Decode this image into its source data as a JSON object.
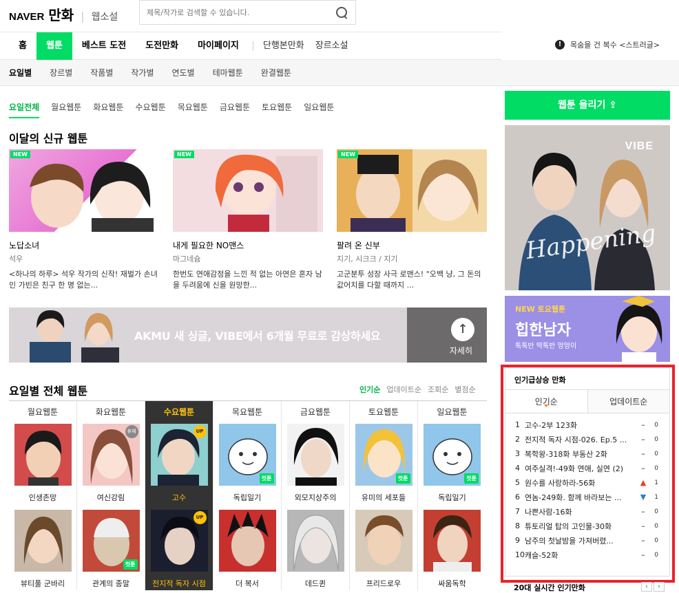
{
  "header": {
    "brand": "NAVER",
    "service": "만화",
    "sub": "웹소설",
    "search_placeholder": "제목/작가로 검색할 수 있습니다."
  },
  "gnb": {
    "items": [
      "홈",
      "웹툰",
      "베스트 도전",
      "도전만화",
      "마이페이지"
    ],
    "extra": [
      "단행본만화",
      "장르소설"
    ],
    "notice": "목숨을 건 복수 <스트러글>"
  },
  "subgnb": [
    "요일별",
    "장르별",
    "작품별",
    "작가별",
    "연도별",
    "테마웹툰",
    "완결웹툰"
  ],
  "daytabs": [
    "요일전체",
    "월요웹툰",
    "화요웹툰",
    "수요웹툰",
    "목요웹툰",
    "금요웹툰",
    "토요웹툰",
    "일요웹툰"
  ],
  "new_section": {
    "title": "이달의 신규 웹툰",
    "badge": "NEW",
    "cards": [
      {
        "title": "노답소녀",
        "author": "석우",
        "desc": "<하나의 하루> 석우 작가의 신작! 재벌가 손녀인 가빈은 친구 한 명 없는..."
      },
      {
        "title": "내게 필요한 NO맨스",
        "author": "마그네슘",
        "desc": "한번도 연애감정을 느낀 적 없는 아연은 혼자 남을 두려움에 신을 원망한..."
      },
      {
        "title": "팔려 온 신부",
        "author": "지기, 시크크 / 지기",
        "desc": "고군분투 성장 사극 로맨스! \"오백 냥, 그 돈의 값어치를 다할 때까지 ..."
      }
    ]
  },
  "banner": {
    "text": "AKMU 새 싱글, VIBE에서 6개월 무료로 감상하세요",
    "more": "자세히"
  },
  "daily": {
    "title": "요일별 전체 웹툰",
    "sorts": [
      "인기순",
      "업데이트순",
      "조회순",
      "별점순"
    ],
    "columns": [
      {
        "day": "월요웹툰",
        "items": [
          "인생존망",
          "뷰티풀 군바리"
        ]
      },
      {
        "day": "화요웹툰",
        "items": [
          "여신강림",
          "관계의 종말"
        ]
      },
      {
        "day": "수요웹툰",
        "items": [
          "고수",
          "전지적 독자 시점"
        ]
      },
      {
        "day": "목요웹툰",
        "items": [
          "독립일기",
          "더 복서"
        ]
      },
      {
        "day": "금요웹툰",
        "items": [
          "외모지상주의",
          "데드퀸"
        ]
      },
      {
        "day": "토요웹툰",
        "items": [
          "유미의 세포들",
          "프리드로우"
        ]
      },
      {
        "day": "일요웹툰",
        "items": [
          "독립일기",
          "싸움독학"
        ]
      }
    ],
    "badges": {
      "up": "UP",
      "rest": "휴재",
      "cut": "컷툰"
    }
  },
  "right": {
    "upload": "웹툰 올리기",
    "vibe": {
      "logo": "VIBE",
      "script": "Happening"
    },
    "promo": {
      "label": "NEW 토요웹툰",
      "title": "힙한남자",
      "desc": "톡톡반 딱톡반 엉엉이"
    },
    "ranking": {
      "title": "인기급상승 만화",
      "tabs": [
        "인기순",
        "업데이트순"
      ],
      "items": [
        {
          "n": "1",
          "t": "고수-2부 123화",
          "chg": "–",
          "cnt": "0"
        },
        {
          "n": "2",
          "t": "전지적 독자 시점-026. Ep.5 ...",
          "chg": "–",
          "cnt": "0"
        },
        {
          "n": "3",
          "t": "복학왕-318화 부동산 2화",
          "chg": "–",
          "cnt": "0"
        },
        {
          "n": "4",
          "t": "여주실격!-49화 연애, 실연 (2)",
          "chg": "–",
          "cnt": "0"
        },
        {
          "n": "5",
          "t": "원수를 사랑하라-56화",
          "chg": "▲",
          "cnt": "1"
        },
        {
          "n": "6",
          "t": "연놈-249화. 함께 바라보는 ...",
          "chg": "▼",
          "cnt": "1"
        },
        {
          "n": "7",
          "t": "나쁜사람-16화",
          "chg": "–",
          "cnt": "0"
        },
        {
          "n": "8",
          "t": "튜토리얼 탑의 고인물-30화",
          "chg": "–",
          "cnt": "0"
        },
        {
          "n": "9",
          "t": "남주의 첫날밤을 가져버렸...",
          "chg": "–",
          "cnt": "0"
        },
        {
          "n": "10",
          "t": "캐슬-52화",
          "chg": "–",
          "cnt": "0"
        }
      ]
    },
    "realtime": "20대 실시간 인기만화",
    "colors": {
      "up": "#e8401c",
      "down": "#2b7fd4"
    }
  }
}
